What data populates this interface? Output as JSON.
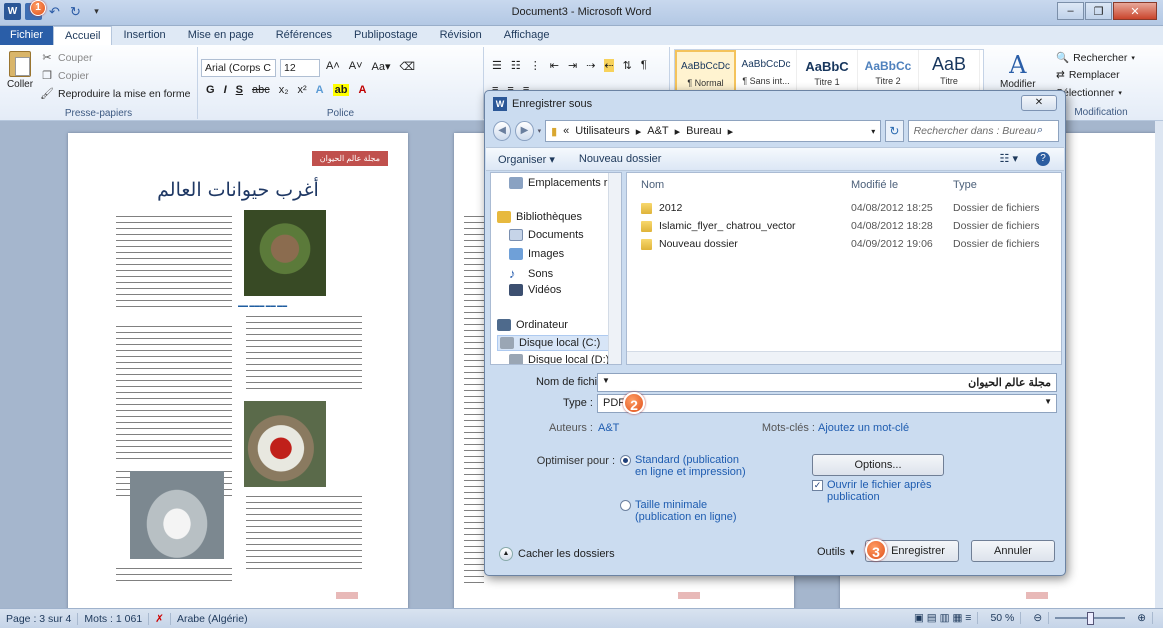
{
  "window": {
    "title": "Document3 - Microsoft Word"
  },
  "ribbon_tabs": [
    "Fichier",
    "Accueil",
    "Insertion",
    "Mise en page",
    "Références",
    "Publipostage",
    "Révision",
    "Affichage"
  ],
  "clipboard": {
    "paste": "Coller",
    "cut": "Couper",
    "copy": "Copier",
    "format_painter": "Reproduire la mise en forme",
    "label": "Presse-papiers"
  },
  "font": {
    "name": "Arial (Corps C",
    "size": "12",
    "label": "Police"
  },
  "styles": [
    {
      "preview": "AaBbCcDc",
      "name": "¶ Normal"
    },
    {
      "preview": "AaBbCcDc",
      "name": "¶ Sans int..."
    },
    {
      "preview": "AaBbC",
      "name": "Titre 1"
    },
    {
      "preview": "AaBbCc",
      "name": "Titre 2"
    },
    {
      "preview": "AaB",
      "name": "Titre"
    }
  ],
  "change_styles": "Modifier",
  "editing": {
    "find": "Rechercher",
    "replace": "Remplacer",
    "select": "Sélectionner",
    "label": "Modification"
  },
  "document": {
    "header_tag": "مجلة عالم الحيوان",
    "title": "أغرب حيوانات العالم"
  },
  "statusbar": {
    "page": "Page : 3 sur 4",
    "words": "Mots : 1 061",
    "language": "Arabe (Algérie)",
    "zoom": "50 %"
  },
  "dialog": {
    "title": "Enregistrer sous",
    "breadcrumb": [
      "«",
      "Utilisateurs",
      "A&T",
      "Bureau"
    ],
    "search_placeholder": "Rechercher dans : Bureau",
    "toolbar": {
      "organize": "Organiser",
      "new_folder": "Nouveau dossier"
    },
    "nav": [
      {
        "label": "Emplacements ré",
        "kind": "recent"
      },
      {
        "label": "Bibliothèques",
        "kind": "library"
      },
      {
        "label": "Documents",
        "kind": "docs"
      },
      {
        "label": "Images",
        "kind": "images"
      },
      {
        "label": "Sons",
        "kind": "music"
      },
      {
        "label": "Vidéos",
        "kind": "video"
      },
      {
        "label": "Ordinateur",
        "kind": "computer"
      },
      {
        "label": "Disque local (C:)",
        "kind": "disk",
        "selected": true
      },
      {
        "label": "Disque local (D:)",
        "kind": "disk"
      }
    ],
    "columns": {
      "name": "Nom",
      "modified": "Modifié le",
      "type": "Type"
    },
    "files": [
      {
        "name": "2012",
        "modified": "04/08/2012 18:25",
        "type": "Dossier de fichiers"
      },
      {
        "name": "Islamic_flyer_ chatrou_vector",
        "modified": "04/08/2012 18:28",
        "type": "Dossier de fichiers"
      },
      {
        "name": "Nouveau dossier",
        "modified": "04/09/2012 19:06",
        "type": "Dossier de fichiers"
      }
    ],
    "filename_label": "Nom de fichier :",
    "filename": "مجلة عالم الحيوان",
    "type_label": "Type :",
    "type_value": "PDF",
    "authors_label": "Auteurs :",
    "authors_value": "A&T",
    "tags_label": "Mots-clés :",
    "tags_value": "Ajoutez un mot-clé",
    "optimize_label": "Optimiser pour :",
    "opt_standard": "Standard (publication en ligne et impression)",
    "opt_minimal": "Taille minimale (publication en ligne)",
    "options_button": "Options...",
    "open_after": "Ouvrir le fichier après publication",
    "hide_folders": "Cacher les dossiers",
    "tools": "Outils",
    "save": "Enregistrer",
    "cancel": "Annuler"
  },
  "badges": [
    "1",
    "2",
    "3"
  ]
}
